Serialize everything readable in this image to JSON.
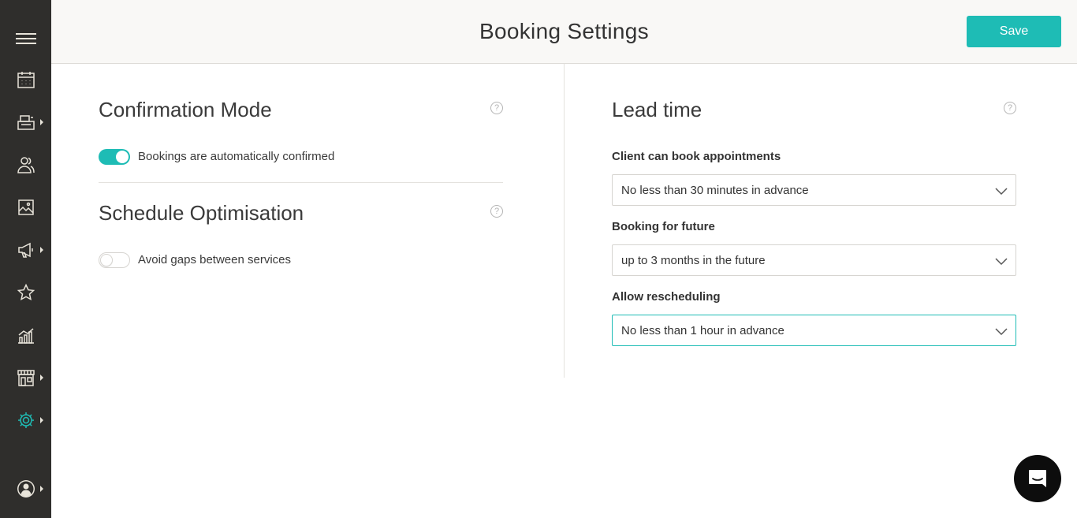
{
  "header": {
    "title": "Booking Settings",
    "save_label": "Save"
  },
  "sidebar": {
    "items": [
      {
        "icon": "menu-icon",
        "has_submenu": false
      },
      {
        "icon": "calendar-icon",
        "has_submenu": false
      },
      {
        "icon": "register-icon",
        "has_submenu": true
      },
      {
        "icon": "clients-icon",
        "has_submenu": false
      },
      {
        "icon": "gallery-icon",
        "has_submenu": false
      },
      {
        "icon": "megaphone-icon",
        "has_submenu": true
      },
      {
        "icon": "star-icon",
        "has_submenu": false
      },
      {
        "icon": "analytics-icon",
        "has_submenu": false
      },
      {
        "icon": "store-icon",
        "has_submenu": true
      },
      {
        "icon": "gear-icon",
        "has_submenu": true,
        "active": true
      },
      {
        "icon": "user-avatar-icon",
        "has_submenu": true
      }
    ],
    "icon_color": "#e8e4da",
    "active_color": "#1ebcb5"
  },
  "confirmation": {
    "title": "Confirmation Mode",
    "toggle_label": "Bookings are automatically confirmed",
    "enabled": true
  },
  "optimisation": {
    "title": "Schedule Optimisation",
    "toggle_label": "Avoid gaps between services",
    "enabled": false
  },
  "lead_time": {
    "title": "Lead time",
    "fields": [
      {
        "label": "Client can book appointments",
        "value": "No less than 30 minutes in advance"
      },
      {
        "label": "Booking for future",
        "value": "up to 3 months in the future"
      },
      {
        "label": "Allow rescheduling",
        "value": "No less than 1 hour in advance",
        "focused": true
      }
    ]
  },
  "help_glyph": "?",
  "colors": {
    "accent": "#1ebcb5",
    "sidebar_bg": "#2f2e2c",
    "header_bg": "#f9f8f6"
  }
}
